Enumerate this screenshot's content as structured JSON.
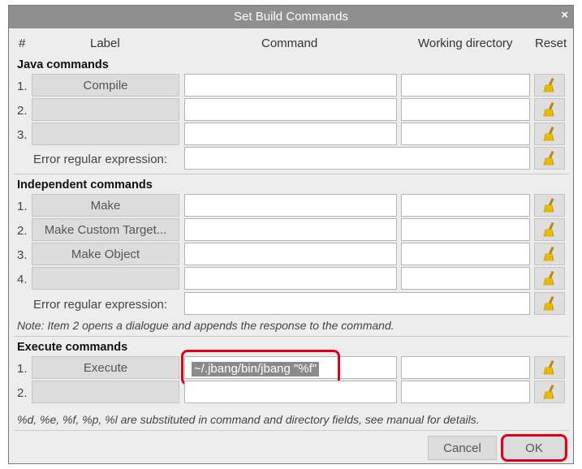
{
  "dialog": {
    "title": "Set Build Commands",
    "close": "×"
  },
  "headers": {
    "num": "#",
    "label": "Label",
    "command": "Command",
    "dir": "Working directory",
    "reset": "Reset"
  },
  "java": {
    "title": "Java commands",
    "rows": [
      {
        "num": "1.",
        "label": "Compile",
        "command": "",
        "dir": ""
      },
      {
        "num": "2.",
        "label": "",
        "command": "",
        "dir": ""
      },
      {
        "num": "3.",
        "label": "",
        "command": "",
        "dir": ""
      }
    ],
    "error_label": "Error regular expression:"
  },
  "independent": {
    "title": "Independent commands",
    "rows": [
      {
        "num": "1.",
        "label": "Make",
        "command": "",
        "dir": ""
      },
      {
        "num": "2.",
        "label": "Make Custom Target...",
        "command": "",
        "dir": ""
      },
      {
        "num": "3.",
        "label": "Make Object",
        "command": "",
        "dir": ""
      },
      {
        "num": "4.",
        "label": "",
        "command": "",
        "dir": ""
      }
    ],
    "error_label": "Error regular expression:",
    "note": "Note: Item 2 opens a dialogue and appends the response to the command."
  },
  "execute": {
    "title": "Execute commands",
    "rows": [
      {
        "num": "1.",
        "label": "Execute",
        "command": "~/.jbang/bin/jbang \"%f\"",
        "dir": ""
      },
      {
        "num": "2.",
        "label": "",
        "command": "",
        "dir": ""
      }
    ]
  },
  "footer_note": "%d, %e, %f, %p, %l are substituted in command and directory fields, see manual for details.",
  "buttons": {
    "cancel": "Cancel",
    "ok": "OK"
  },
  "colors": {
    "highlight": "#e0001a",
    "titlebar": "#8f8f8f",
    "dialog_bg": "#ededed"
  },
  "icons": {
    "reset": "broom-icon"
  }
}
